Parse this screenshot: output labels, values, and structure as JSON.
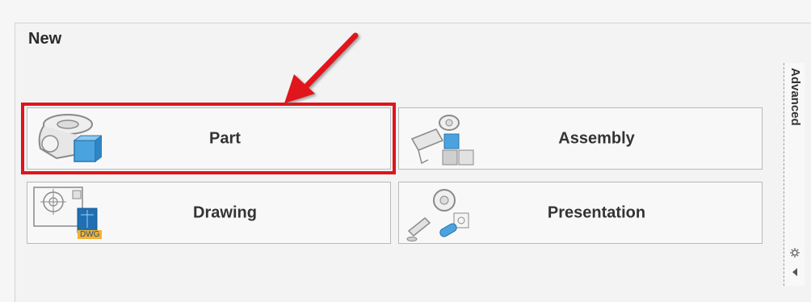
{
  "panel": {
    "title": "New"
  },
  "tiles": [
    {
      "label": "Part",
      "icon": "part-icon"
    },
    {
      "label": "Assembly",
      "icon": "assembly-icon"
    },
    {
      "label": "Drawing",
      "icon": "drawing-icon",
      "badge": "DWG"
    },
    {
      "label": "Presentation",
      "icon": "presentation-icon"
    }
  ],
  "side_tab": {
    "label": "Advanced"
  },
  "colors": {
    "highlight": "#e0131b",
    "accent_blue": "#4aa3df"
  }
}
